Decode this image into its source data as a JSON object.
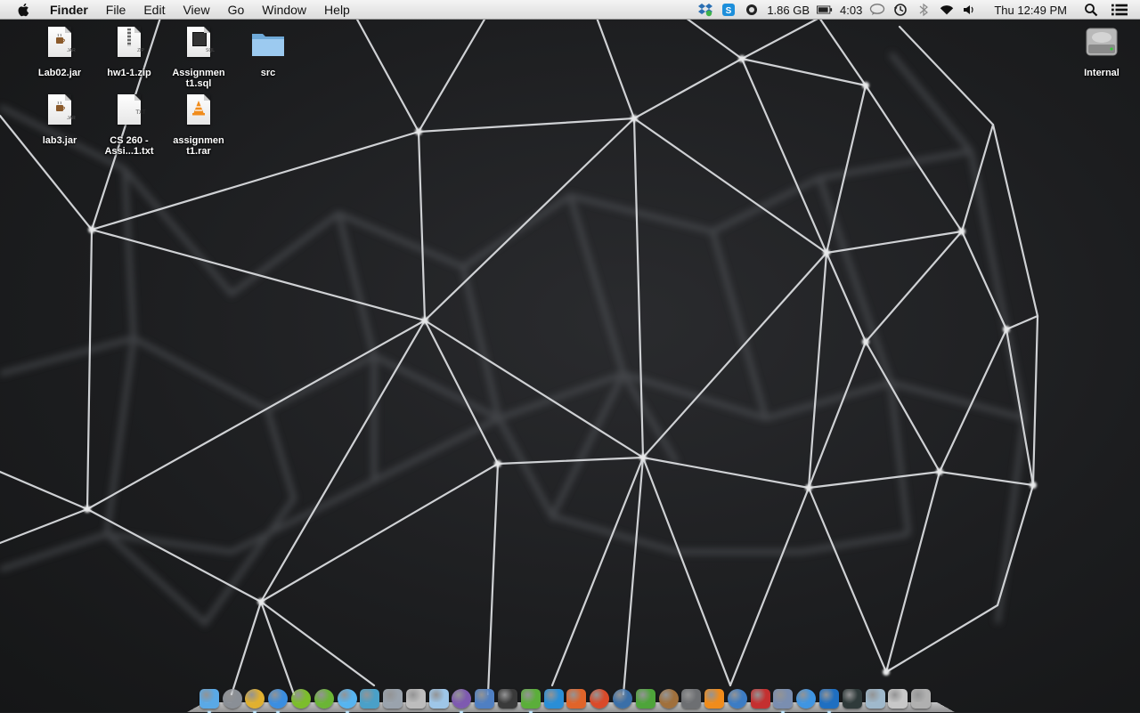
{
  "menubar": {
    "app_name": "Finder",
    "items": [
      "File",
      "Edit",
      "View",
      "Go",
      "Window",
      "Help"
    ],
    "status": {
      "memory": "1.86 GB",
      "battery": "4:03",
      "clock": "Thu 12:49 PM"
    },
    "status_icons": [
      "dropbox-icon",
      "skype-icon",
      "memory-gauge-icon",
      "battery-icon",
      "messages-icon",
      "time-machine-icon",
      "bluetooth-icon",
      "wifi-icon",
      "volume-icon",
      "spotlight-icon",
      "notification-center-icon"
    ]
  },
  "desktop_icons": [
    {
      "label": "Lab02.jar",
      "kind": "jar",
      "tag": "JAR"
    },
    {
      "label": "hw1-1.zip",
      "kind": "zip",
      "tag": "ZIP"
    },
    {
      "label": "Assignmen\nt1.sql",
      "kind": "sql",
      "tag": "SQL"
    },
    {
      "label": "src",
      "kind": "folder",
      "tag": ""
    },
    {
      "label": "lab3.jar",
      "kind": "jar",
      "tag": "JAR"
    },
    {
      "label": "CS 260 -\nAssi...1.txt",
      "kind": "txt",
      "tag": "TXT"
    },
    {
      "label": "assignmen\nt1.rar",
      "kind": "rar",
      "tag": ""
    },
    {
      "label": "Internal",
      "kind": "drive",
      "tag": ""
    }
  ],
  "dock": {
    "items": [
      {
        "name": "finder",
        "color": "#5aa9e6",
        "running": true,
        "round": false
      },
      {
        "name": "launchpad",
        "color": "#8a8f96",
        "running": false,
        "round": true
      },
      {
        "name": "chrome",
        "color": "#e0b030",
        "running": true,
        "round": true
      },
      {
        "name": "itunes",
        "color": "#3b8ee0",
        "running": true,
        "round": true
      },
      {
        "name": "spotify",
        "color": "#7cbd2b",
        "running": false,
        "round": true
      },
      {
        "name": "utorrent",
        "color": "#6bb536",
        "running": false,
        "round": true
      },
      {
        "name": "messages",
        "color": "#56b4f0",
        "running": true,
        "round": true
      },
      {
        "name": "migration",
        "color": "#4aa0c8",
        "running": false,
        "round": false
      },
      {
        "name": "tools",
        "color": "#9aa3ad",
        "running": false,
        "round": false
      },
      {
        "name": "vlc-preview",
        "color": "#bdbdbd",
        "running": false,
        "round": false
      },
      {
        "name": "virtualbox",
        "color": "#9ec6e8",
        "running": false,
        "round": false
      },
      {
        "name": "eclipse",
        "color": "#7e5ab0",
        "running": true,
        "round": true
      },
      {
        "name": "xcode",
        "color": "#4f7fc2",
        "running": false,
        "round": false
      },
      {
        "name": "terminal",
        "color": "#3a3a3a",
        "running": false,
        "round": false
      },
      {
        "name": "evernote",
        "color": "#5bae3a",
        "running": true,
        "round": false
      },
      {
        "name": "word",
        "color": "#2a8ed6",
        "running": false,
        "round": false
      },
      {
        "name": "powerpoint",
        "color": "#e0642a",
        "running": false,
        "round": false
      },
      {
        "name": "sync",
        "color": "#d94a2a",
        "running": false,
        "round": true
      },
      {
        "name": "x11",
        "color": "#3a6fa8",
        "running": false,
        "round": true
      },
      {
        "name": "battery-app",
        "color": "#4ea43a",
        "running": false,
        "round": false
      },
      {
        "name": "pot-app",
        "color": "#a0703c",
        "running": false,
        "round": true
      },
      {
        "name": "imovie",
        "color": "#6d6f72",
        "running": false,
        "round": false
      },
      {
        "name": "vlc",
        "color": "#f08c1c",
        "running": false,
        "round": false
      },
      {
        "name": "quicktime",
        "color": "#3c7cc4",
        "running": false,
        "round": true
      },
      {
        "name": "photo-booth",
        "color": "#c43030",
        "running": false,
        "round": false
      },
      {
        "name": "preview",
        "color": "#7a8eb0",
        "running": true,
        "round": false
      },
      {
        "name": "app-store",
        "color": "#3f95e2",
        "running": false,
        "round": true
      },
      {
        "name": "teamviewer",
        "color": "#1f6fc1",
        "running": true,
        "round": false
      },
      {
        "name": "activity-monitor",
        "color": "#2f3a3a",
        "running": false,
        "round": false
      },
      {
        "name": "downloads",
        "color": "#9fb9cc",
        "running": false,
        "round": false
      },
      {
        "name": "documents",
        "color": "#c8c8c8",
        "running": false,
        "round": false
      },
      {
        "name": "trash",
        "color": "#b0b0b0",
        "running": false,
        "round": false
      }
    ]
  }
}
